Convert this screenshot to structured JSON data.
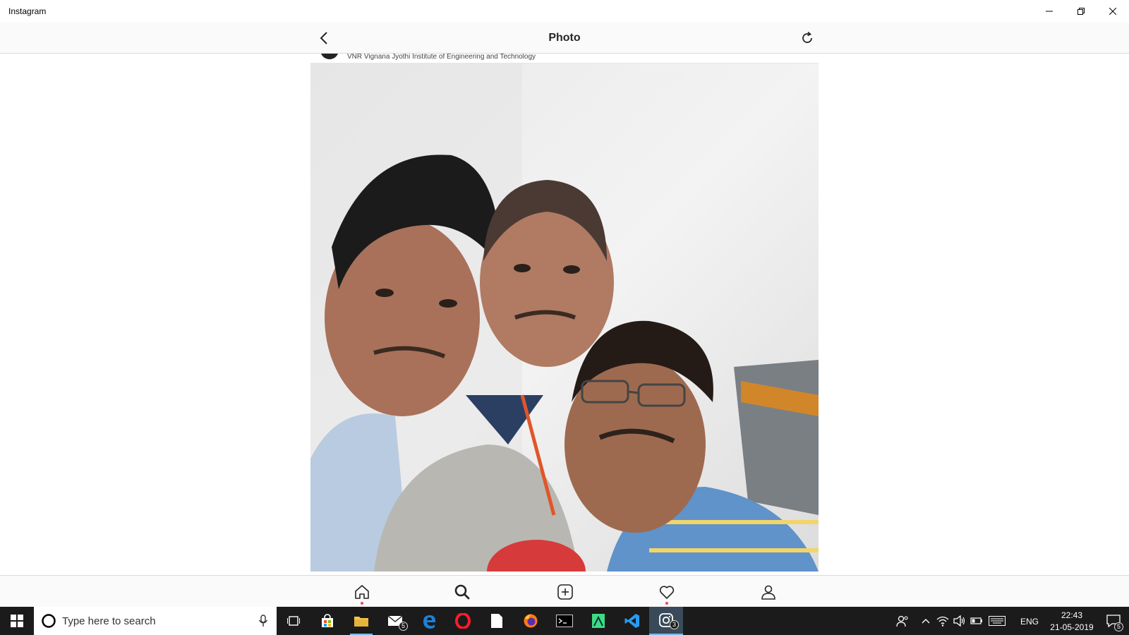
{
  "window": {
    "title": "Instagram"
  },
  "header": {
    "title": "Photo"
  },
  "post": {
    "location": "VNR Vignana Jyothi Institute of Engineering and Technology",
    "photo_alt": "Selfie photo"
  },
  "bottom_nav": {
    "items": [
      {
        "icon": "home-icon",
        "has_notification": true
      },
      {
        "icon": "search-icon",
        "active": true
      },
      {
        "icon": "add-post-icon"
      },
      {
        "icon": "activity-heart-icon",
        "has_notification": true
      },
      {
        "icon": "profile-icon"
      }
    ]
  },
  "taskbar": {
    "search_placeholder": "Type here to search",
    "mail_badge": "5",
    "instagram_badge": "3",
    "language": "ENG",
    "time": "22:43",
    "date": "21-05-2019",
    "notification_count": "5"
  },
  "colors": {
    "accent_blue": "#76b9ed",
    "notification_red": "#ed4956",
    "taskbar_bg": "#1b1b1b"
  }
}
